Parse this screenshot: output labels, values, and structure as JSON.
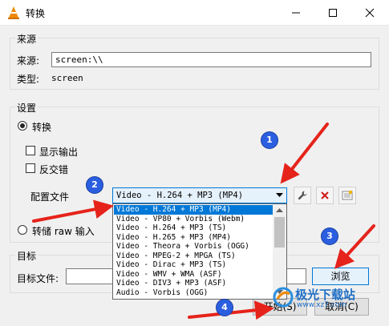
{
  "window": {
    "title": "转换"
  },
  "source_group": {
    "label": "来源",
    "source_label": "来源:",
    "source_value": "screen:\\\\",
    "type_label": "类型:",
    "type_value": "screen"
  },
  "settings_group": {
    "label": "设置",
    "convert_label": "转换",
    "show_output_label": "显示输出",
    "deinterlace_label": "反交错",
    "profile_label": "配置文件",
    "dump_raw_label": "转储 raw 输入",
    "profile_selected": "Video - H.264 + MP3 (MP4)",
    "profile_options": [
      "Video - H.264 + MP3 (MP4)",
      "Video - VP80 + Vorbis (Webm)",
      "Video - H.264 + MP3 (TS)",
      "Video - H.265 + MP3 (MP4)",
      "Video - Theora + Vorbis (OGG)",
      "Video - MPEG-2 + MPGA (TS)",
      "Video - Dirac + MP3 (TS)",
      "Video - WMV + WMA (ASF)",
      "Video - DIV3 + MP3 (ASF)",
      "Audio - Vorbis (OGG)"
    ]
  },
  "target_group": {
    "label": "目标",
    "file_label": "目标文件:",
    "file_value": "",
    "browse_label": "浏览"
  },
  "footer": {
    "start_label": "开始(S)",
    "cancel_label": "取消(C)"
  },
  "annotations": [
    "1",
    "2",
    "3",
    "4"
  ],
  "watermark": {
    "name": "极光下载站",
    "url": "www.xz7.com"
  },
  "colors": {
    "selection": "#0078d7",
    "badge": "#2b5fe0",
    "arrow": "#e5231b",
    "delete_icon": "#d11a1a"
  }
}
